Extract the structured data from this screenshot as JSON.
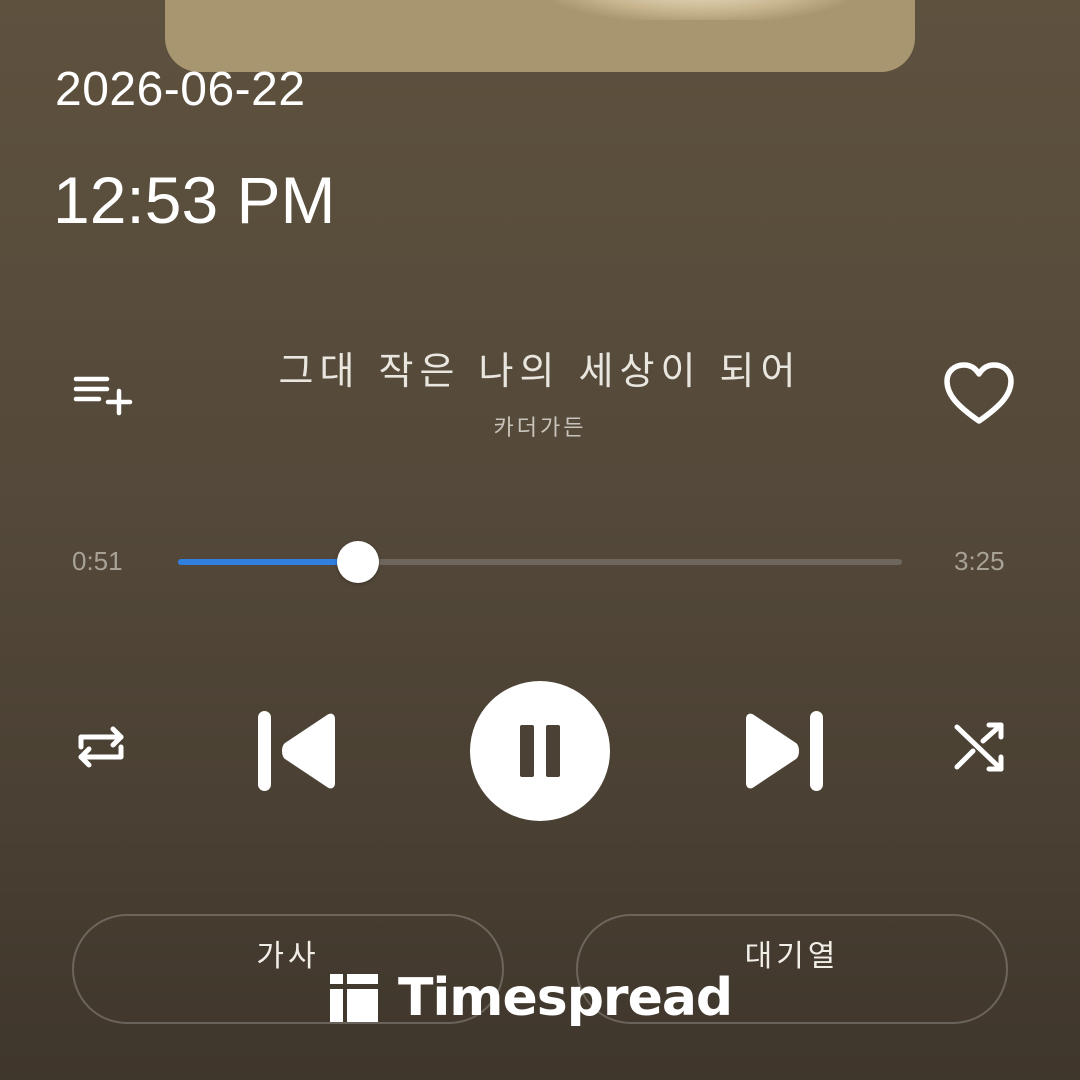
{
  "album_art": {
    "background": "#a89670"
  },
  "clock": {
    "date": "2026-06-22",
    "time": "12:53 PM"
  },
  "now_playing": {
    "title": "그대 작은 나의 세상이 되어",
    "artist": "카더가든",
    "liked": false
  },
  "progress": {
    "elapsed": "0:51",
    "duration": "3:25",
    "fraction": 0.2488,
    "fill_color": "#2f7fe0"
  },
  "controls": {
    "add_to_playlist_icon": "playlist-add-icon",
    "like_icon": "heart-outline-icon",
    "repeat_icon": "repeat-icon",
    "previous_icon": "skip-previous-icon",
    "play_pause_icon": "pause-icon",
    "next_icon": "skip-next-icon",
    "shuffle_icon": "shuffle-icon"
  },
  "bottom_buttons": {
    "lyrics_label": "가사",
    "queue_label": "대기열"
  },
  "watermark": {
    "text": "Timespread"
  }
}
